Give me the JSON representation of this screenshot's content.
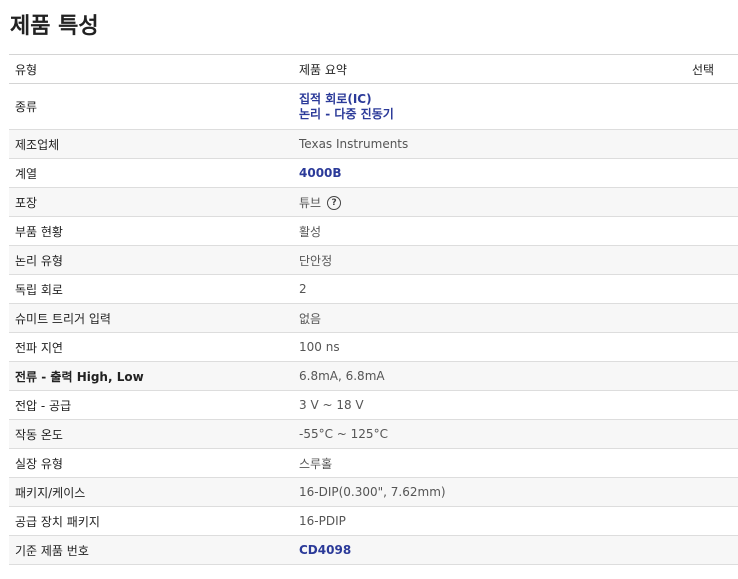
{
  "page": {
    "title": "제품 특성"
  },
  "table": {
    "headers": {
      "type": "유형",
      "summary": "제품 요약",
      "select": "선택"
    },
    "rows": [
      {
        "label": "종류",
        "value_lines": [
          "집적 회로(IC)",
          "논리 - 다중 진동기"
        ],
        "link": true
      },
      {
        "label": "제조업체",
        "value": "Texas Instruments"
      },
      {
        "label": "계열",
        "value": "4000B",
        "link": true
      },
      {
        "label": "포장",
        "value": "튜브",
        "icon": "help-icon"
      },
      {
        "label": "부품 현황",
        "value": "활성"
      },
      {
        "label": "논리 유형",
        "value": "단안정"
      },
      {
        "label": "독립 회로",
        "value": "2"
      },
      {
        "label": "슈미트 트리거 입력",
        "value": "없음"
      },
      {
        "label": "전파 지연",
        "value": "100 ns"
      },
      {
        "label_prefix": "전류 - 출력 ",
        "label_bold": "High, Low",
        "value": "6.8mA, 6.8mA"
      },
      {
        "label": "전압 - 공급",
        "value": "3 V ~ 18 V"
      },
      {
        "label": "작동 온도",
        "value": "-55°C ~ 125°C"
      },
      {
        "label": "실장 유형",
        "value": "스루홀"
      },
      {
        "label": "패키지/케이스",
        "value": "16-DIP(0.300\", 7.62mm)"
      },
      {
        "label": "공급 장치 패키지",
        "value": "16-PDIP"
      },
      {
        "label": "기준 제품 번호",
        "value": "CD4098",
        "link": true
      }
    ]
  },
  "colors": {
    "link": "#2b3a99",
    "row_alt": "#f7f7f7",
    "border": "#dddddd"
  }
}
